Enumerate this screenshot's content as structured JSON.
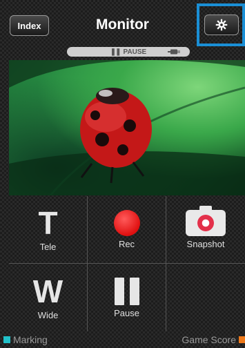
{
  "header": {
    "index_label": "Index",
    "title": "Monitor",
    "settings_icon": "gear-icon"
  },
  "status": {
    "state_label": "PAUSE",
    "battery_icon": "battery-icon"
  },
  "controls": [
    {
      "label": "Tele",
      "glyph": "T"
    },
    {
      "label": "Rec",
      "icon": "record-dot-icon"
    },
    {
      "label": "Snapshot",
      "icon": "camera-icon"
    },
    {
      "label": "Wide",
      "glyph": "W"
    },
    {
      "label": "Pause",
      "icon": "pause-icon"
    }
  ],
  "bottom": {
    "left_label": "Marking",
    "right_label": "Game Score"
  },
  "colors": {
    "highlight": "#1a8fd6",
    "rec": "#e01010",
    "marking": "#21c1c9",
    "game_score": "#f07a1a"
  }
}
